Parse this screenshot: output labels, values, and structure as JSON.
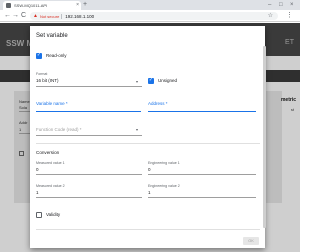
{
  "browser": {
    "tab_title": "SSW-MQ1011-API",
    "tab_close": "×",
    "new_tab": "+",
    "window_controls": [
      "–",
      "□",
      "×"
    ],
    "nav": [
      "←",
      "→",
      "C"
    ],
    "security_icon": "warning-icon",
    "security_text": "Not secure",
    "url": "192.168.1.100",
    "star": "☆",
    "menu": "⋮"
  },
  "background_app": {
    "title": "SSW M",
    "right_text": "ET",
    "panel_label_1": "Name",
    "panel_value_1": "Sola",
    "panel_label_2": "Addr",
    "panel_value_2": "1",
    "right_label": "metric",
    "right_value": "st"
  },
  "dialog": {
    "title": "Set variable",
    "read_only": {
      "label": "Read-only",
      "checked": true
    },
    "format": {
      "label": "Format",
      "value": "16 bit (INT)"
    },
    "unsigned": {
      "label": "Unsigned",
      "checked": true
    },
    "variable_name": {
      "label": "Variable name *",
      "value": ""
    },
    "address": {
      "label": "Address *",
      "value": ""
    },
    "function_code": {
      "label": "Function Code (read) *",
      "value": ""
    },
    "conversion": {
      "title": "Conversion",
      "measured_1": {
        "label": "Measured value 1",
        "value": "0"
      },
      "engineering_1": {
        "label": "Engineering value 1",
        "value": "0"
      },
      "measured_2": {
        "label": "Measured value 2",
        "value": "1"
      },
      "engineering_2": {
        "label": "Engineering value 2",
        "value": "1"
      }
    },
    "validity": {
      "label": "Validity",
      "checked": false
    },
    "ok_label": "OK",
    "colors": {
      "accent": "#1a73e8",
      "warning": "#d93025"
    }
  }
}
